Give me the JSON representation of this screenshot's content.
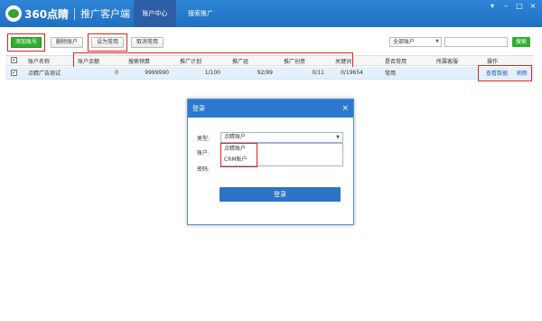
{
  "app": {
    "logo_text": "360点睛",
    "subtitle": "推广客户端",
    "tabs": [
      "账户中心",
      "搜索推广"
    ],
    "window_controls": [
      "▾",
      "–",
      "□",
      "×"
    ]
  },
  "toolbar": {
    "add_account": "添加账号",
    "delete_account": "删除账户",
    "set_common": "设为常用",
    "cancel_common": "取消常用",
    "filter_selected": "全部账户",
    "search_value": "",
    "search_button": "搜索"
  },
  "table": {
    "headers": [
      "账户名称",
      "账户余额",
      "搜索预算",
      "推广计划",
      "推广组",
      "推广创意",
      "关键词",
      "是否常用",
      "所属客服",
      "操作"
    ],
    "rows": [
      {
        "checked": true,
        "name": "点睛广告测试",
        "balance": "0",
        "budget": "9999990",
        "plans": "1/100",
        "groups": "92/99",
        "creatives": "0/11",
        "keywords": "0/19654",
        "common": "常用",
        "service": "",
        "action_view": "查看数据",
        "action_refresh": "刷新"
      }
    ],
    "header_checked": true
  },
  "modal": {
    "title": "登录",
    "type_label": "类型:",
    "type_value": "点睛账户",
    "account_label": "账户:",
    "password_label": "密码:",
    "options": [
      "点睛账户",
      "CRM账户"
    ],
    "login_button": "登录"
  },
  "colors": {
    "titlebar": "#1f6fc2",
    "green": "#2fae2f",
    "highlight": "#dd2222",
    "link": "#1f5fbf"
  }
}
